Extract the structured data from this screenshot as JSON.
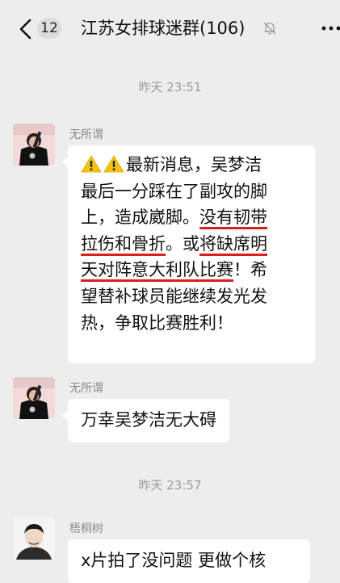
{
  "header": {
    "unread_count": "12",
    "group_title": "江苏女排球迷群(106)"
  },
  "colors": {
    "background": "#ededed",
    "bubble": "#ffffff",
    "underline": "#d6201a",
    "warning": "#f5c211"
  },
  "icons": [
    "back-arrow-icon",
    "mute-bell-icon",
    "more-dots-icon",
    "warning-icon"
  ],
  "messages": [
    {
      "time": "昨天 23:51",
      "sender": "无所谓",
      "lines": [
        {
          "a": "最新消息，吴梦洁"
        },
        {
          "a": "最后一分踩在了副攻的脚"
        },
        {
          "a": "上，造成崴脚。",
          "b": "没有韧带"
        },
        {
          "b": "拉伤和骨折",
          "c": "。或",
          "d": "将缺席明"
        },
        {
          "d": "天对阵意大利队比赛",
          "e": "！希"
        },
        {
          "a": "望替补球员能继续发光发"
        },
        {
          "a": "热，争取比赛胜利！"
        }
      ]
    },
    {
      "sender": "无所谓",
      "text": "万幸吴梦洁无大碍"
    },
    {
      "time": "昨天 23:57",
      "sender": "梧桐树",
      "text": "x片拍了没问题 更做个核"
    }
  ]
}
